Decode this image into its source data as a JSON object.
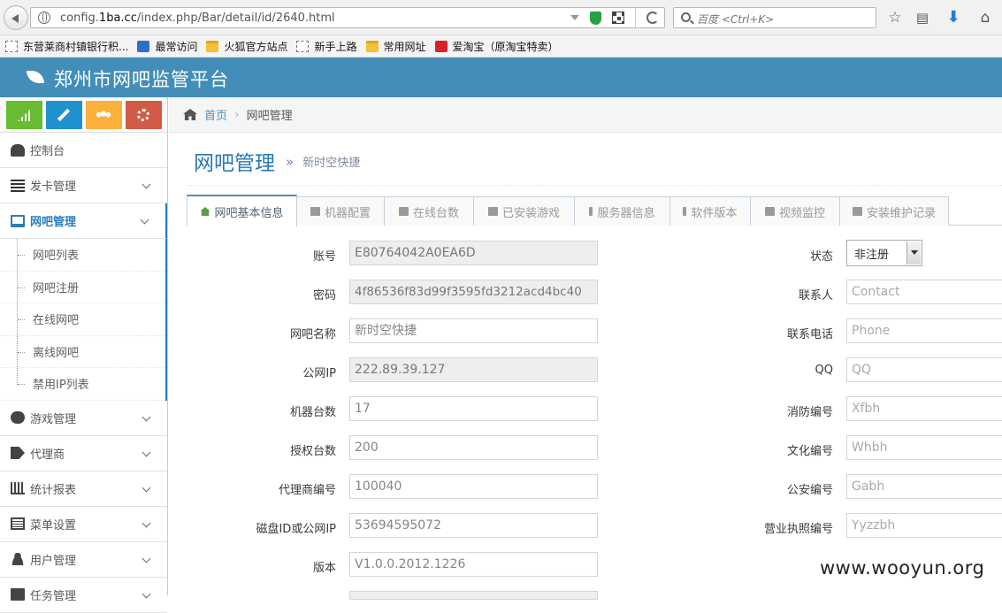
{
  "browser": {
    "url_prefix": "config.",
    "url_domain": "1ba.cc",
    "url_path": "/index.php/Bar/detail/id/2640.html",
    "search_placeholder": "百度 <Ctrl+K>",
    "bookmarks": [
      {
        "label": "东营莱商村镇银行积...",
        "icon": "dashed-page-icon"
      },
      {
        "label": "最常访问",
        "icon": "blue-page-icon"
      },
      {
        "label": "火狐官方站点",
        "icon": "folder-icon"
      },
      {
        "label": "新手上路",
        "icon": "dashed-page-icon"
      },
      {
        "label": "常用网址",
        "icon": "folder-icon"
      },
      {
        "label": "爱淘宝（原淘宝特卖）",
        "icon": "taobao-icon"
      }
    ]
  },
  "app": {
    "title": "郑州市网吧监管平台",
    "header_color": "#438eb9"
  },
  "sidebar": {
    "shortcuts": [
      {
        "icon": "signal-icon",
        "color": "#68bc31"
      },
      {
        "icon": "pencil-icon",
        "color": "#2091cf"
      },
      {
        "icon": "users-icon",
        "color": "#fcb03c"
      },
      {
        "icon": "cogs-icon",
        "color": "#d15b47"
      }
    ],
    "items": [
      {
        "label": "控制台",
        "icon": "dashboard-icon"
      },
      {
        "label": "发卡管理",
        "icon": "list-icon"
      },
      {
        "label": "网吧管理",
        "icon": "desktop-icon",
        "active": true
      },
      {
        "label": "游戏管理",
        "icon": "gamepad-icon"
      },
      {
        "label": "代理商",
        "icon": "tag-icon"
      },
      {
        "label": "统计报表",
        "icon": "bar-chart-icon"
      },
      {
        "label": "菜单设置",
        "icon": "list-alt-icon"
      },
      {
        "label": "用户管理",
        "icon": "user-icon"
      },
      {
        "label": "任务管理",
        "icon": "tasks-icon"
      }
    ],
    "submenu": [
      "网吧列表",
      "网吧注册",
      "在线网吧",
      "离线网吧",
      "禁用IP列表"
    ]
  },
  "breadcrumb": {
    "home": "首页",
    "current": "网吧管理"
  },
  "page": {
    "title": "网吧管理",
    "subtitle": "新时空快捷"
  },
  "tabs": [
    {
      "label": "网吧基本信息",
      "active": true
    },
    {
      "label": "机器配置"
    },
    {
      "label": "在线台数"
    },
    {
      "label": "已安装游戏"
    },
    {
      "label": "服务器信息"
    },
    {
      "label": "软件版本"
    },
    {
      "label": "视频监控"
    },
    {
      "label": "安装维护记录"
    }
  ],
  "form_left": [
    {
      "label": "账号",
      "value": "E80764042A0EA6D",
      "readonly": true
    },
    {
      "label": "密码",
      "value": "4f86536f83d99f3595fd3212acd4bc40",
      "readonly": true
    },
    {
      "label": "网吧名称",
      "value": "新时空快捷"
    },
    {
      "label": "公网IP",
      "value": "222.89.39.127",
      "readonly": true
    },
    {
      "label": "机器台数",
      "value": "17"
    },
    {
      "label": "授权台数",
      "value": "200"
    },
    {
      "label": "代理商编号",
      "value": "100040"
    },
    {
      "label": "磁盘ID或公网IP",
      "value": "53694595072"
    },
    {
      "label": "版本",
      "value": "V1.0.0.2012.1226"
    }
  ],
  "form_right": {
    "status_label": "状态",
    "status_value": "非注册",
    "fields": [
      {
        "label": "联系人",
        "placeholder": "Contact"
      },
      {
        "label": "联系电话",
        "placeholder": "Phone"
      },
      {
        "label": "QQ",
        "placeholder": "QQ"
      },
      {
        "label": "消防编号",
        "placeholder": "Xfbh"
      },
      {
        "label": "文化编号",
        "placeholder": "Whbh"
      },
      {
        "label": "公安编号",
        "placeholder": "Gabh"
      },
      {
        "label": "营业执照编号",
        "placeholder": "Yyzzbh"
      }
    ]
  },
  "watermark": "www.wooyun.org"
}
